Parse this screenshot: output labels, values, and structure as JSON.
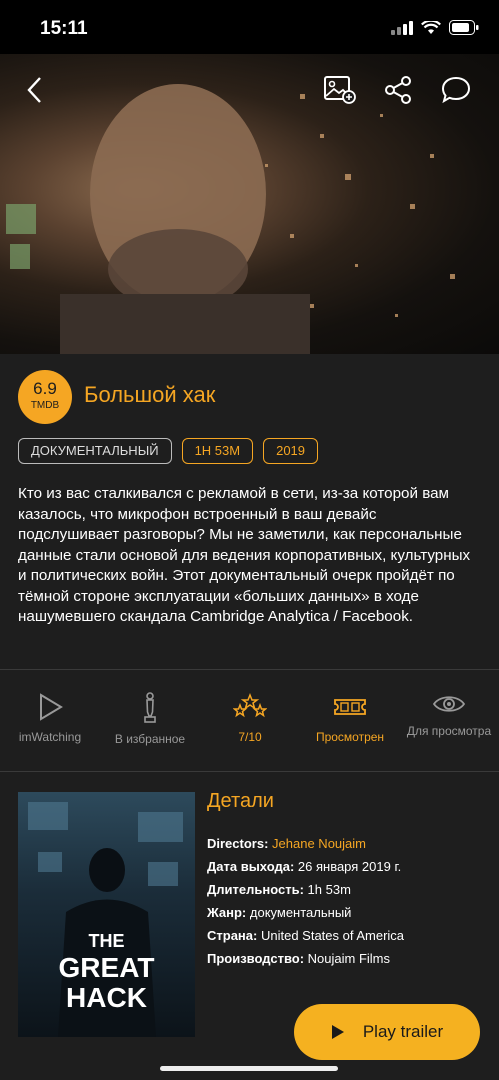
{
  "status_bar": {
    "time": "15:11"
  },
  "movie": {
    "title": "Большой хак",
    "rating": "6.9",
    "rating_source": "TMDB",
    "tags": {
      "genre": "ДОКУМЕНТАЛЬНЫЙ",
      "duration": "1H 53M",
      "year": "2019"
    },
    "description": "Кто из вас сталкивался с рекламой в сети, из-за которой вам казалось, что микрофон встроенный в ваш девайс подслушивает разговоры? Мы не заметили, как персональные данные стали основой для ведения корпоративных, культурных и политических войн. Этот документальный очерк пройдёт по тёмной стороне эксплуатации «больших данных» в ходе нашумевшего скандала Cambridge Analytica / Facebook."
  },
  "actions": {
    "imwatching": "imWatching",
    "favorites": "В избранное",
    "rating": "7/10",
    "watched": "Просмотрен",
    "watchlist": "Для просмотра"
  },
  "poster": {
    "line1": "THE",
    "line2": "GREAT",
    "line3": "HACK"
  },
  "details": {
    "heading": "Детали",
    "directors_key": "Directors:",
    "directors_val": "Jehane Noujaim",
    "release_key": "Дата выхода:",
    "release_val": "26 января 2019 г.",
    "duration_key": "Длительность:",
    "duration_val": "1h 53m",
    "genre_key": "Жанр:",
    "genre_val": "документальный",
    "country_key": "Страна:",
    "country_val": "United States of America",
    "production_key": "Производство:",
    "production_val": "Noujaim Films"
  },
  "play_trailer": "Play trailer",
  "colors": {
    "accent": "#f5a623",
    "background": "#1e1e1e",
    "muted": "#999999"
  }
}
